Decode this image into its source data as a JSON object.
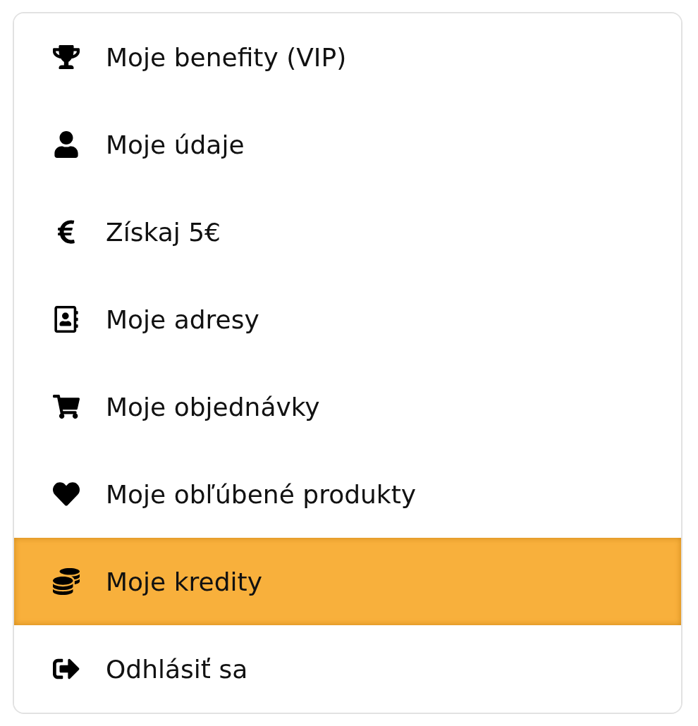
{
  "menu": {
    "items": [
      {
        "label": "Moje benefity (VIP)",
        "selected": false
      },
      {
        "label": "Moje údaje",
        "selected": false
      },
      {
        "label": "Získaj 5€",
        "selected": false
      },
      {
        "label": "Moje adresy",
        "selected": false
      },
      {
        "label": "Moje objednávky",
        "selected": false
      },
      {
        "label": "Moje obľúbené produkty",
        "selected": false
      },
      {
        "label": "Moje kredity",
        "selected": true
      },
      {
        "label": "Odhlásiť sa",
        "selected": false
      }
    ]
  }
}
